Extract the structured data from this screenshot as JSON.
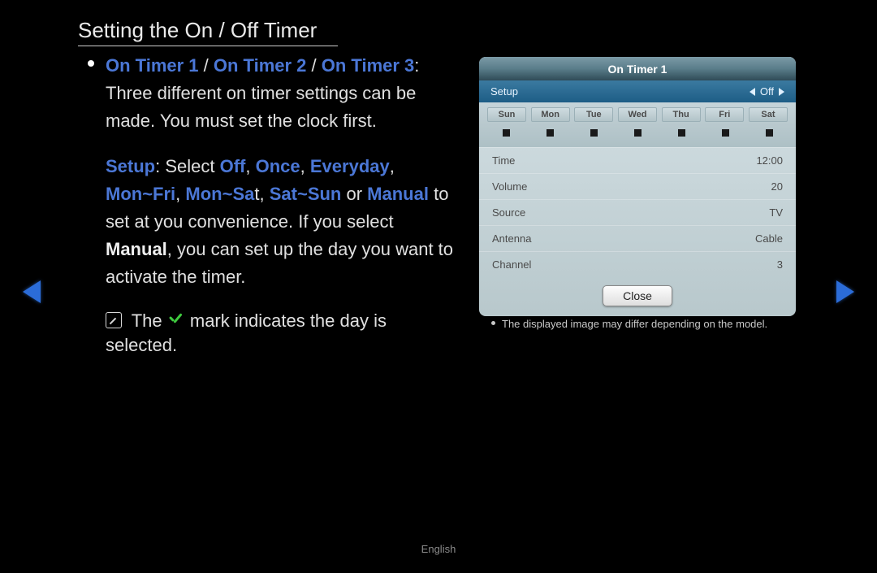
{
  "title": "Setting the On / Off Timer",
  "bullet1": {
    "hl_timer1": "On Timer 1",
    "sep1": " / ",
    "hl_timer2": "On Timer 2",
    "sep2": " / ",
    "hl_timer3": "On Timer 3",
    "rest": ": Three different on timer settings can be made. You must set the clock first."
  },
  "para2": {
    "hl_setup": "Setup",
    "t1": ": Select ",
    "hl_off": "Off",
    "c1": ", ",
    "hl_once": "Once",
    "c2": ", ",
    "hl_everyday": "Everyday",
    "c3": ", ",
    "hl_monfri": "Mon~Fri",
    "c4": ", ",
    "hl_monsat": "Mon~Sa",
    "monsat_tail": "t",
    "c5": ", ",
    "hl_satsun": "Sat~Sun",
    "t2": " or ",
    "hl_manual": "Manual",
    "t3": " to set at you convenience. If you select ",
    "bold_manual": "Manual",
    "t4": ", you can set up the day you want to activate the timer."
  },
  "note": {
    "pre": "The ",
    "post": " mark indicates the day is selected."
  },
  "panel": {
    "title": "On Timer 1",
    "setup_label": "Setup",
    "setup_value": "Off",
    "days": [
      "Sun",
      "Mon",
      "Tue",
      "Wed",
      "Thu",
      "Fri",
      "Sat"
    ],
    "rows": [
      {
        "label": "Time",
        "value": "12:00"
      },
      {
        "label": "Volume",
        "value": "20"
      },
      {
        "label": "Source",
        "value": "TV"
      },
      {
        "label": "Antenna",
        "value": "Cable"
      },
      {
        "label": "Channel",
        "value": "3"
      }
    ],
    "close": "Close"
  },
  "disclaimer": "The displayed image may differ depending on the model.",
  "language": "English"
}
